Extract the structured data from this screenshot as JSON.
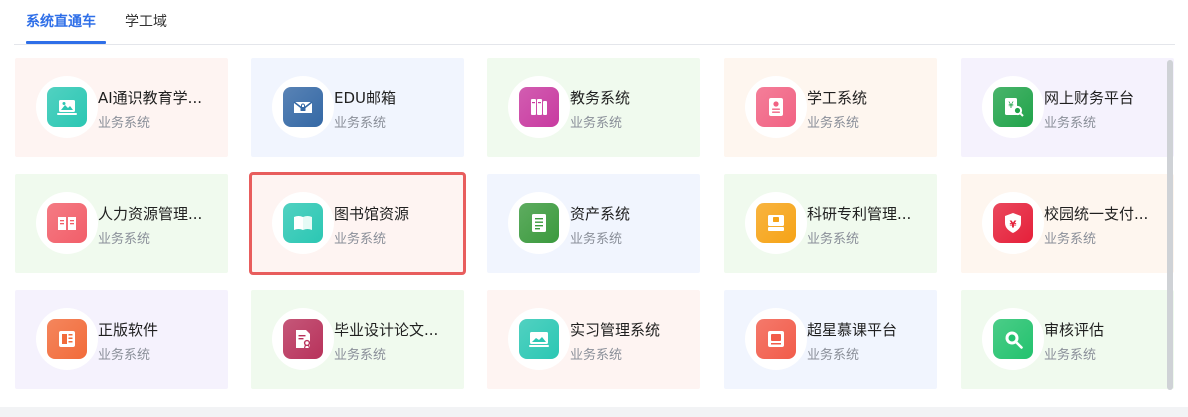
{
  "tabs": [
    {
      "label": "系统直通车"
    },
    {
      "label": "学工域"
    }
  ],
  "cards": [
    {
      "title": "AI通识教育学...",
      "subtitle": "业务系统",
      "icon": "image-board-icon",
      "bg": "#fef4f2",
      "icon_color": "#2bc7b3"
    },
    {
      "title": "EDU邮箱",
      "subtitle": "业务系统",
      "icon": "mail-lock-icon",
      "bg": "#f1f5fe",
      "icon_color": "#3468a5"
    },
    {
      "title": "教务系统",
      "subtitle": "业务系统",
      "icon": "books-icon",
      "bg": "#f0faee",
      "icon_color": "#c83aa0"
    },
    {
      "title": "学工系统",
      "subtitle": "业务系统",
      "icon": "id-card-icon",
      "bg": "#fef6ef",
      "icon_color": "#f16283"
    },
    {
      "title": "网上财务平台",
      "subtitle": "业务系统",
      "icon": "finance-search-icon",
      "bg": "#f5f2fd",
      "icon_color": "#21a34a"
    },
    {
      "title": "人力资源管理...",
      "subtitle": "业务系统",
      "icon": "open-book-icon",
      "bg": "#f0faee",
      "icon_color": "#f25e69"
    },
    {
      "title": "图书馆资源",
      "subtitle": "业务系统",
      "icon": "book-icon",
      "bg": "#fef4f2",
      "icon_color": "#2bc7b3",
      "selected": true
    },
    {
      "title": "资产系统",
      "subtitle": "业务系统",
      "icon": "ledger-icon",
      "bg": "#f1f5fe",
      "icon_color": "#3b9a3d"
    },
    {
      "title": "科研专利管理...",
      "subtitle": "业务系统",
      "icon": "patent-book-icon",
      "bg": "#f0faee",
      "icon_color": "#f6a316"
    },
    {
      "title": "校园统一支付...",
      "subtitle": "业务系统",
      "icon": "yuan-shield-icon",
      "bg": "#fef6ef",
      "icon_color": "#e5203a"
    },
    {
      "title": "正版软件",
      "subtitle": "业务系统",
      "icon": "software-box-icon",
      "bg": "#f5f2fd",
      "icon_color": "#f26b3a"
    },
    {
      "title": "毕业设计论文...",
      "subtitle": "业务系统",
      "icon": "thesis-icon",
      "bg": "#f0faee",
      "icon_color": "#b8325b"
    },
    {
      "title": "实习管理系统",
      "subtitle": "业务系统",
      "icon": "internship-board-icon",
      "bg": "#fef4f2",
      "icon_color": "#2bc7b3"
    },
    {
      "title": "超星慕课平台",
      "subtitle": "业务系统",
      "icon": "mooc-icon",
      "bg": "#f1f5fe",
      "icon_color": "#f25c4a"
    },
    {
      "title": "审核评估",
      "subtitle": "业务系统",
      "icon": "review-search-icon",
      "bg": "#f0faee",
      "icon_color": "#23c26e"
    }
  ]
}
